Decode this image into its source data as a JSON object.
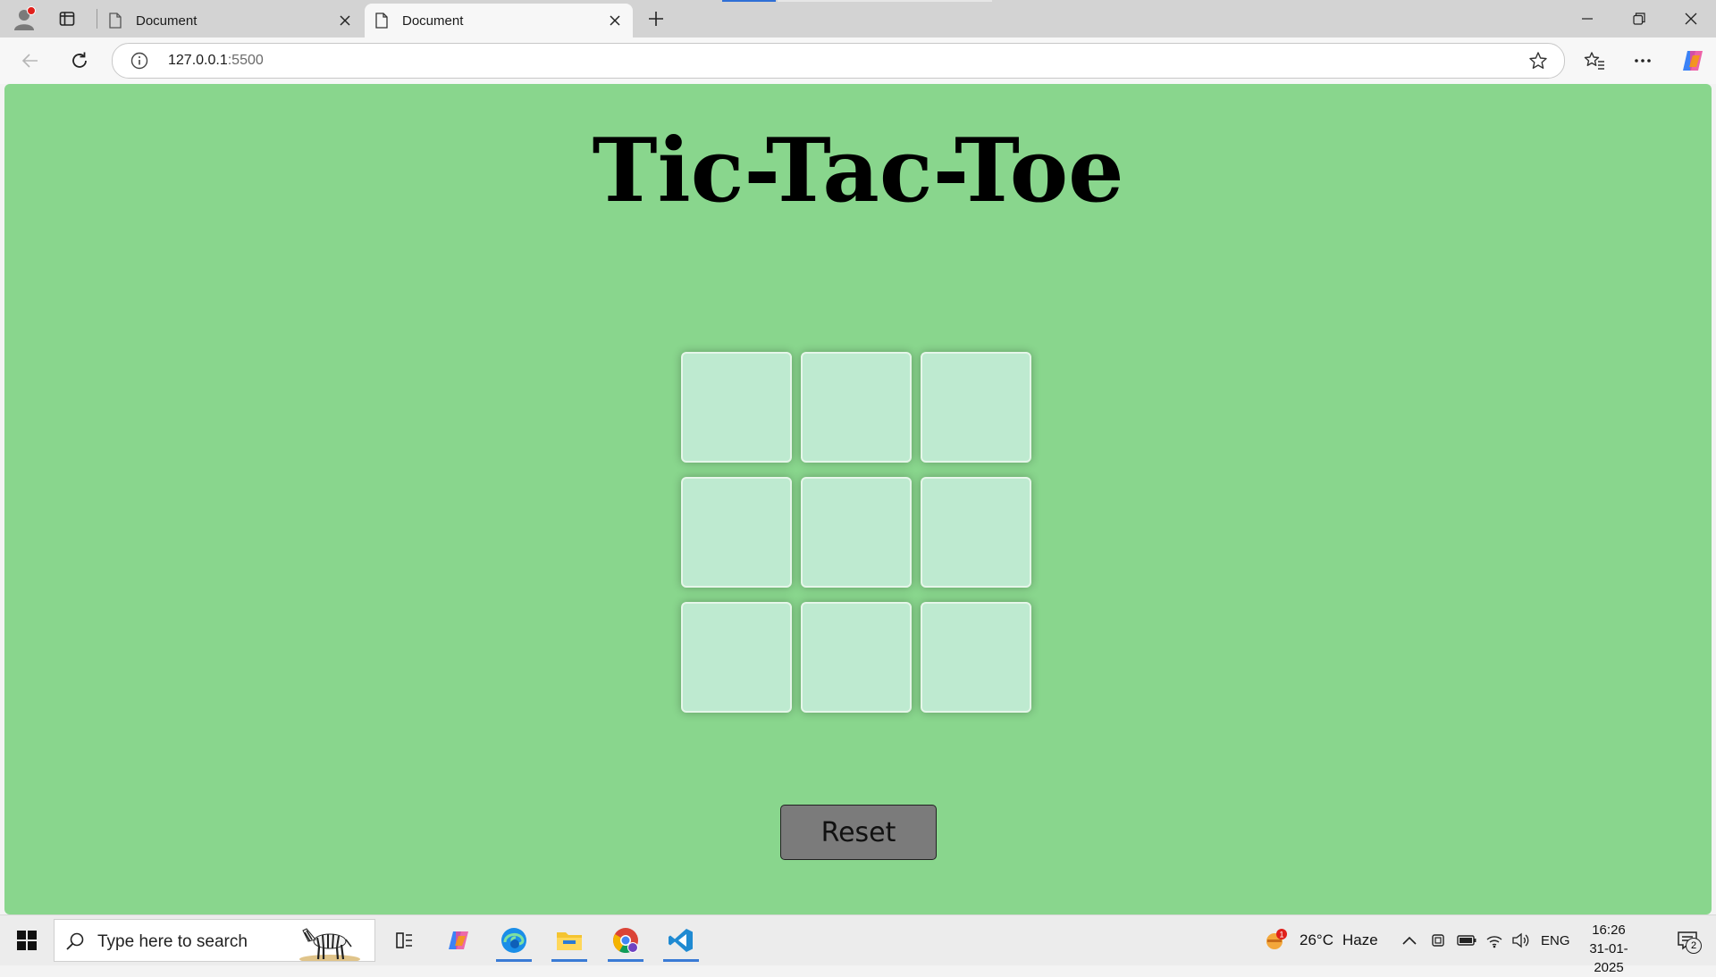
{
  "browser": {
    "tabs": [
      {
        "title": "Document",
        "active": false
      },
      {
        "title": "Document",
        "active": true
      }
    ],
    "url_host": "127.0.0.1",
    "url_port": ":5500"
  },
  "page": {
    "title": "Tic-Tac-Toe",
    "cells": [
      "",
      "",
      "",
      "",
      "",
      "",
      "",
      "",
      ""
    ],
    "reset_label": "Reset",
    "colors": {
      "background": "#89d68d",
      "cell": "#beead0",
      "reset_button": "#7b7b7b"
    }
  },
  "taskbar": {
    "search_placeholder": "Type here to search",
    "weather": {
      "temp": "26°C",
      "condition": "Haze",
      "alert_count": "1"
    },
    "language": "ENG",
    "time": "16:26",
    "date": "31-01-2025",
    "notification_count": "2",
    "pinned_apps": [
      "task-view-icon",
      "copilot-icon",
      "edge-icon",
      "file-explorer-icon",
      "chrome-icon",
      "vscode-icon"
    ]
  }
}
